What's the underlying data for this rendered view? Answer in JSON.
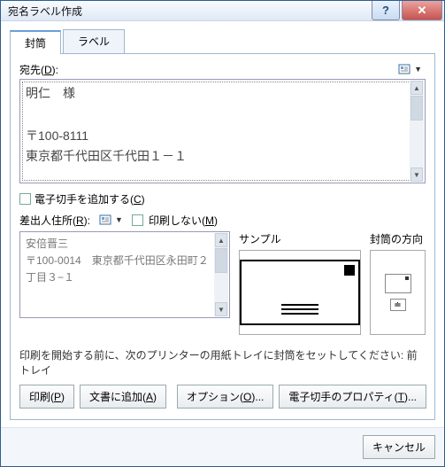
{
  "window": {
    "title": "宛名ラベル作成"
  },
  "tabs": {
    "envelope": "封筒",
    "label": "ラベル"
  },
  "recipient": {
    "label_prefix": "宛先(",
    "label_u": "D",
    "label_suffix": "):",
    "text": "明仁　様\n\n〒100-8111\n東京都千代田区千代田１－１"
  },
  "estamp": {
    "prefix": "電子切手を追加する(",
    "u": "C",
    "suffix": ")"
  },
  "sender": {
    "label_prefix": "差出人住所(",
    "label_u": "R",
    "label_suffix": "):",
    "nopr_prefix": "印刷しない(",
    "nopr_u": "M",
    "nopr_suffix": ")",
    "text": "安倍晋三\n〒100-0014　東京都千代田区永田町２丁目３−１"
  },
  "sample": {
    "header": "サンプル"
  },
  "orient": {
    "header": "封筒の方向"
  },
  "note": "印刷を開始する前に、次のプリンターの用紙トレイに封筒をセットしてください:  前トレイ",
  "buttons": {
    "print_prefix": "印刷(",
    "print_u": "P",
    "print_suffix": ")",
    "add_prefix": "文書に追加(",
    "add_u": "A",
    "add_suffix": ")",
    "opt_prefix": "オプション(",
    "opt_u": "O",
    "opt_suffix": ")...",
    "eprop_prefix": "電子切手のプロパティ(",
    "eprop_u": "T",
    "eprop_suffix": ")...",
    "cancel": "キャンセル"
  }
}
